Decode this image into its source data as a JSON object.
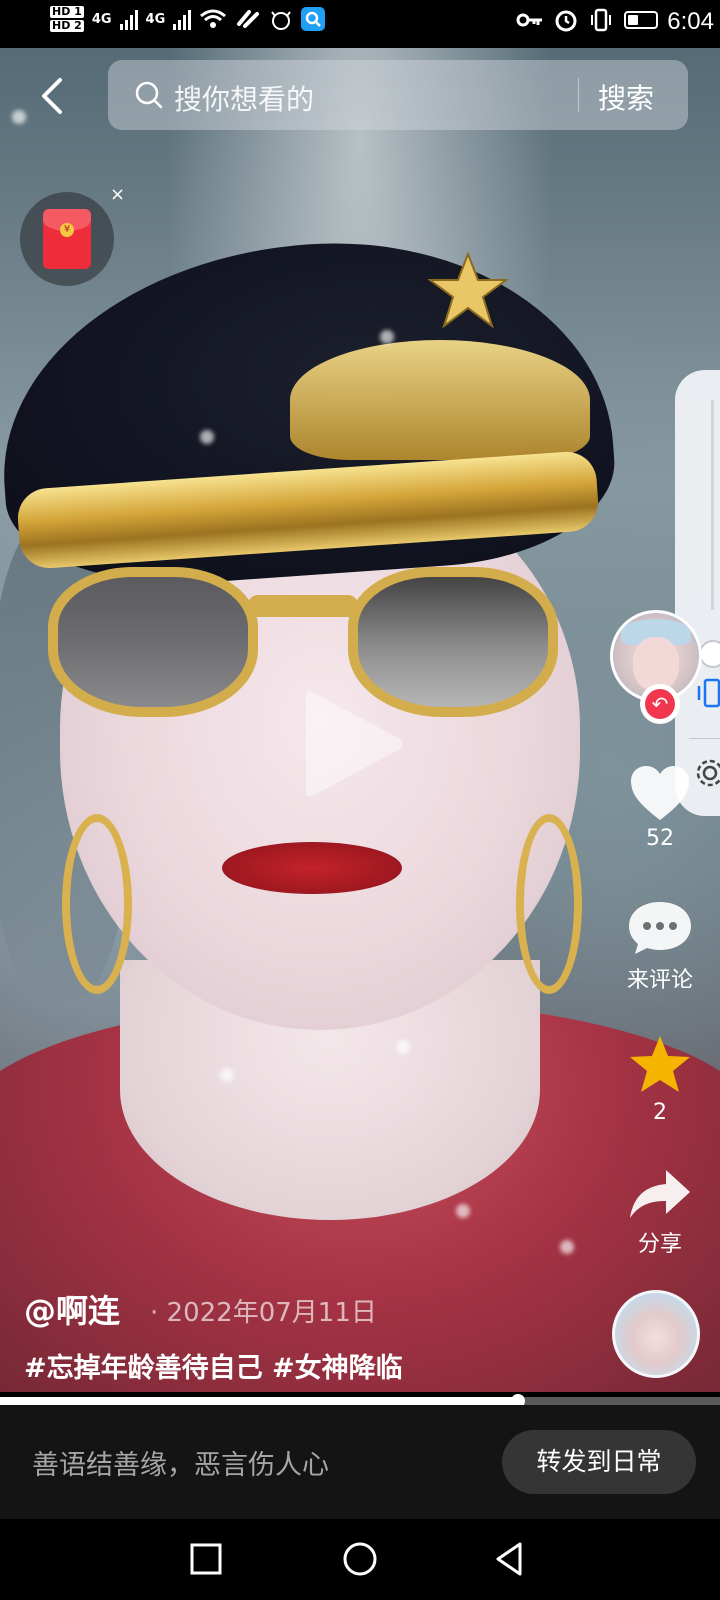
{
  "status_bar": {
    "hd1": "HD 1",
    "hd2": "HD 2",
    "net1": "4G",
    "net2": "4G",
    "time": "6:04"
  },
  "search": {
    "placeholder": "搜你想看的",
    "button": "搜索"
  },
  "red_packet": {
    "coin": "¥",
    "close": "×"
  },
  "rail": {
    "likes": "52",
    "comment_label": "来评论",
    "favorites": "2",
    "share_label": "分享"
  },
  "caption": {
    "author": "@啊连",
    "date": "· 2022年07月11日",
    "tags": "#忘掉年龄善待自己 #女神降临"
  },
  "progress": {
    "fraction": 0.72
  },
  "comment_bar": {
    "placeholder": "善语结善缘，恶言伤人心",
    "forward_button": "转发到日常"
  },
  "colors": {
    "like": "#ffffff",
    "favorite": "#f5b400",
    "follow": "#f0374d"
  },
  "icons": {
    "back": "chevron-left-icon",
    "search": "search-icon",
    "like": "heart-icon",
    "comment": "comment-bubble-icon",
    "favorite": "star-icon",
    "share": "share-arrow-icon",
    "nav": [
      "square-icon",
      "circle-icon",
      "triangle-back-icon"
    ]
  }
}
